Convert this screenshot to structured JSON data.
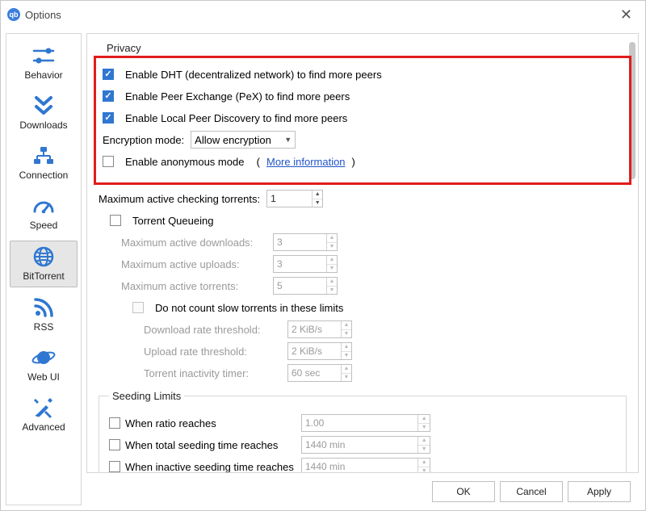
{
  "window": {
    "title": "Options"
  },
  "sidebar": {
    "items": [
      {
        "label": "Behavior"
      },
      {
        "label": "Downloads"
      },
      {
        "label": "Connection"
      },
      {
        "label": "Speed"
      },
      {
        "label": "BitTorrent",
        "selected": true
      },
      {
        "label": "RSS"
      },
      {
        "label": "Web UI"
      },
      {
        "label": "Advanced"
      }
    ]
  },
  "privacy": {
    "legend": "Privacy",
    "dht_label": "Enable DHT (decentralized network) to find more peers",
    "pex_label": "Enable Peer Exchange (PeX) to find more peers",
    "lpd_label": "Enable Local Peer Discovery to find more peers",
    "enc_label": "Encryption mode:",
    "enc_selected": "Allow encryption",
    "anon_label": "Enable anonymous mode",
    "anon_link": "More information",
    "dht_checked": true,
    "pex_checked": true,
    "lpd_checked": true,
    "anon_checked": false
  },
  "queueing": {
    "max_checking_label": "Maximum active checking torrents:",
    "max_checking_value": "1",
    "torrent_queueing_label": "Torrent Queueing",
    "torrent_queueing_checked": false,
    "max_downloads_label": "Maximum active downloads:",
    "max_downloads_value": "3",
    "max_uploads_label": "Maximum active uploads:",
    "max_uploads_value": "3",
    "max_torrents_label": "Maximum active torrents:",
    "max_torrents_value": "5",
    "dont_count_label": "Do not count slow torrents in these limits",
    "dont_count_checked": false,
    "dl_thresh_label": "Download rate threshold:",
    "dl_thresh_value": "2 KiB/s",
    "ul_thresh_label": "Upload rate threshold:",
    "ul_thresh_value": "2 KiB/s",
    "inactivity_label": "Torrent inactivity timer:",
    "inactivity_value": "60 sec"
  },
  "seeding": {
    "legend": "Seeding Limits",
    "ratio_label": "When ratio reaches",
    "ratio_value": "1.00",
    "total_time_label": "When total seeding time reaches",
    "total_time_value": "1440 min",
    "inactive_time_label": "When inactive seeding time reaches",
    "inactive_time_value": "1440 min"
  },
  "footer": {
    "ok": "OK",
    "cancel": "Cancel",
    "apply": "Apply"
  }
}
